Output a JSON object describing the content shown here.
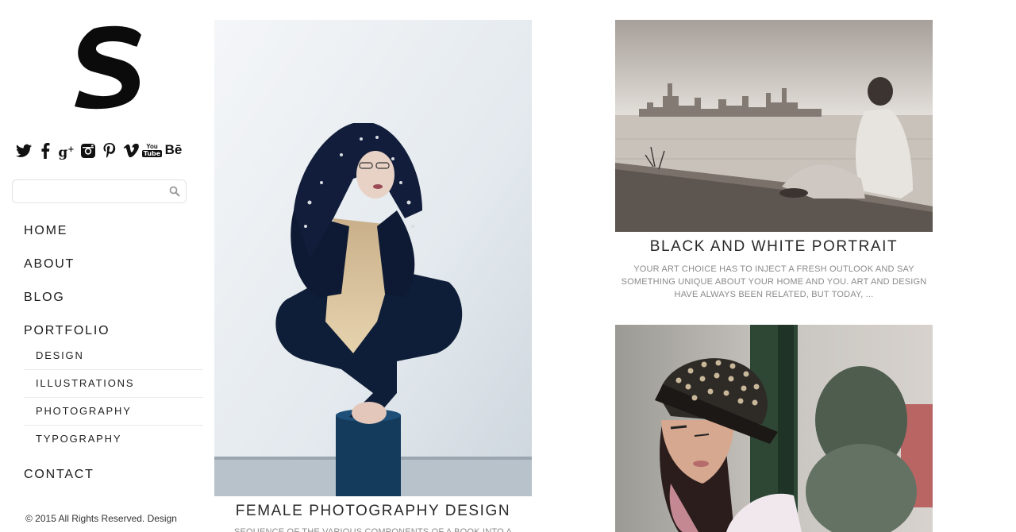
{
  "brand": {
    "logo_icon": "s-logo-icon"
  },
  "social": [
    "twitter-icon",
    "facebook-icon",
    "google-plus-icon",
    "instagram-icon",
    "pinterest-icon",
    "vimeo-icon",
    "youtube-icon",
    "behance-icon"
  ],
  "search": {
    "placeholder": "",
    "value": ""
  },
  "nav": {
    "home": "HOME",
    "about": "ABOUT",
    "blog": "BLOG",
    "portfolio": "PORTFOLIO",
    "portfolio_sub": [
      "DESIGN",
      "ILLUSTRATIONS",
      "PHOTOGRAPHY",
      "TYPOGRAPHY"
    ],
    "contact": "CONTACT"
  },
  "footer": {
    "text": "© 2015 All Rights Reserved. Design"
  },
  "posts": [
    {
      "title": "FEMALE PHOTOGRAPHY DESIGN",
      "excerpt": "SEQUENCE OF THE VARIOUS COMPONENTS OF A BOOK INTO A"
    },
    {
      "title": "BLACK AND WHITE PORTRAIT",
      "excerpt": "YOUR ART CHOICE HAS TO INJECT A FRESH OUTLOOK AND SAY SOMETHING UNIQUE ABOUT YOUR HOME AND YOU. ART AND DESIGN HAVE ALWAYS BEEN RELATED, BUT TODAY, ..."
    },
    {
      "title": "",
      "excerpt": ""
    }
  ],
  "colors": {
    "nav_text": "#1c1c1c",
    "excerpt": "#8a8a8a",
    "divider": "#ebebeb"
  }
}
